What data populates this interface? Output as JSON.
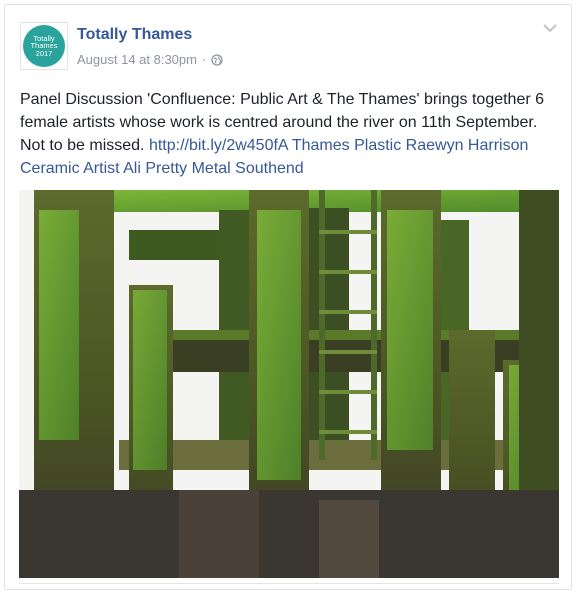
{
  "post": {
    "author": {
      "name": "Totally Thames",
      "avatar_lines": [
        "Totally",
        "Thames",
        "2017"
      ],
      "avatar_color": "#2aa39c"
    },
    "timestamp": "August 14 at 8:30pm",
    "separator": "·",
    "privacy_icon": "globe-icon",
    "menu_icon": "chevron-down-icon",
    "text": "Panel Discussion 'Confluence: Public Art & The Thames' brings together 6 female artists whose work is centred around the river on 11th September. Not to be missed.",
    "link": "http://bit.ly/2w450fA",
    "hashtags_text": "Thames Plastic Raewyn Harrison Ceramic Artist Ali Pretty Metal Southend",
    "image": "photo of moss-covered wooden pier with ladder"
  },
  "colors": {
    "link": "#365899",
    "text": "#1d2129",
    "meta": "#90949c"
  }
}
